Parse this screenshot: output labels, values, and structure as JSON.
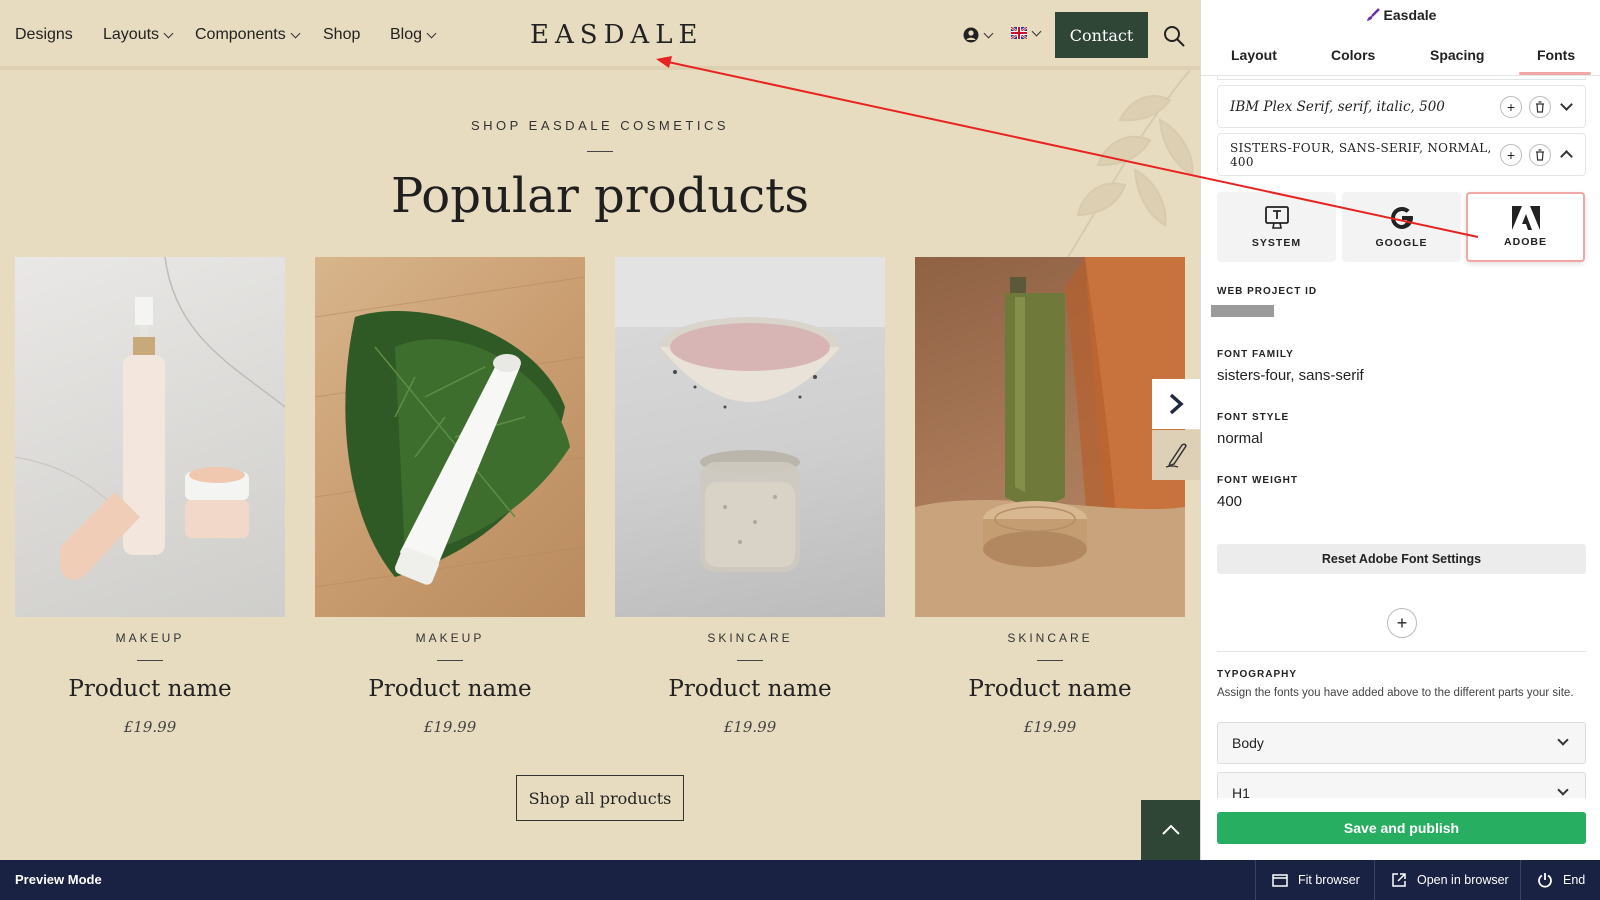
{
  "nav": {
    "items": [
      {
        "label": "Designs",
        "has_menu": false
      },
      {
        "label": "Layouts",
        "has_menu": true
      },
      {
        "label": "Components",
        "has_menu": true
      },
      {
        "label": "Shop",
        "has_menu": false
      },
      {
        "label": "Blog",
        "has_menu": true
      }
    ],
    "logo": "EASDALE",
    "contact_label": "Contact"
  },
  "hero": {
    "eyebrow": "SHOP EASDALE COSMETICS",
    "title": "Popular products"
  },
  "products": [
    {
      "category": "MAKEUP",
      "name": "Product name",
      "price": "£19.99"
    },
    {
      "category": "MAKEUP",
      "name": "Product name",
      "price": "£19.99"
    },
    {
      "category": "SKINCARE",
      "name": "Product name",
      "price": "£19.99"
    },
    {
      "category": "SKINCARE",
      "name": "Product name",
      "price": "£19.99"
    }
  ],
  "shop_all_label": "Shop all products",
  "panel": {
    "title": "Easdale",
    "tabs": [
      "Layout",
      "Colors",
      "Spacing",
      "Fonts"
    ],
    "active_tab": "Fonts",
    "font_rows": [
      "IBM Plex Serif, serif, italic, 500",
      "SISTERS-FOUR, SANS-SERIF, NORMAL, 400"
    ],
    "sources": [
      {
        "label": "SYSTEM",
        "icon": "monitor-icon"
      },
      {
        "label": "GOOGLE",
        "icon": "google-icon"
      },
      {
        "label": "ADOBE",
        "icon": "adobe-icon"
      }
    ],
    "selected_source": "ADOBE",
    "fields": {
      "web_project_id_label": "WEB PROJECT ID",
      "font_family_label": "FONT FAMILY",
      "font_family_value": "sisters-four, sans-serif",
      "font_style_label": "FONT STYLE",
      "font_style_value": "normal",
      "font_weight_label": "FONT WEIGHT",
      "font_weight_value": "400"
    },
    "reset_label": "Reset Adobe Font Settings",
    "typography_title": "TYPOGRAPHY",
    "typography_desc": "Assign the fonts you have added above to the different parts your site.",
    "selects": [
      "Body",
      "H1"
    ],
    "save_label": "Save and publish"
  },
  "bottom_bar": {
    "mode": "Preview Mode",
    "fit_browser": "Fit browser",
    "open_in_browser": "Open in browser",
    "end": "End"
  },
  "colors": {
    "site_bg": "#e8dcc0",
    "accent_dark_green": "#2f4536",
    "save_green": "#27ae60",
    "bottom_bar": "#1a2244",
    "highlight_pink": "#f2a6a6",
    "annotation_red": "#e8231f"
  }
}
